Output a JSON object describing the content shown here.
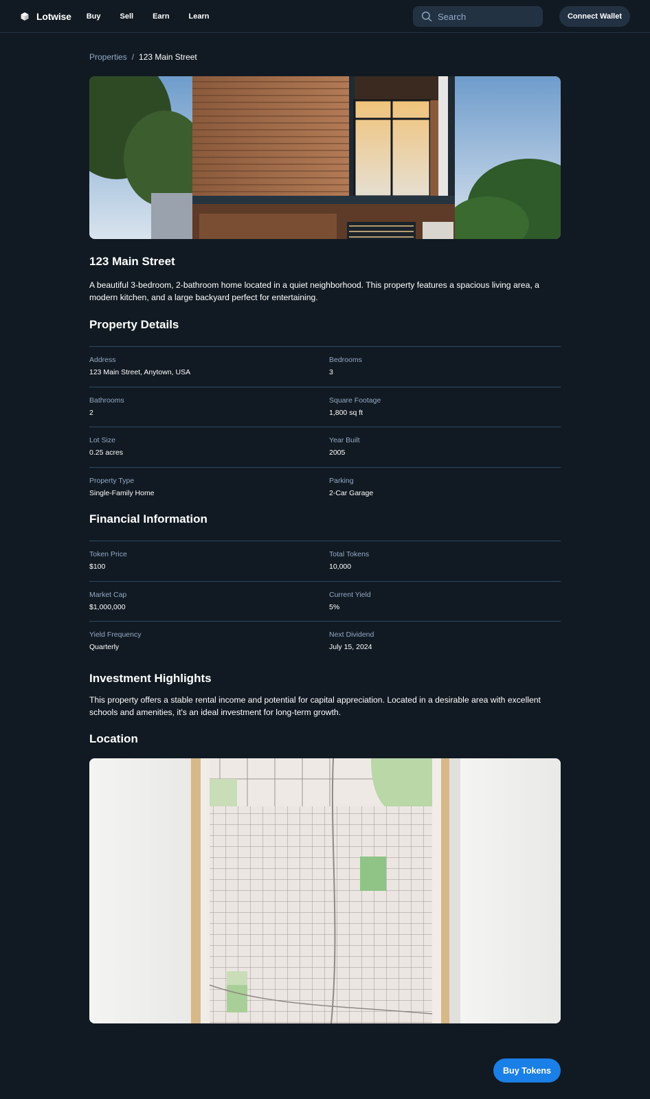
{
  "header": {
    "brand": "Lotwise",
    "nav": [
      "Buy",
      "Sell",
      "Earn",
      "Learn"
    ],
    "search_placeholder": "Search",
    "connect_label": "Connect Wallet"
  },
  "breadcrumb": {
    "parent": "Properties",
    "separator": "/",
    "current": "123 Main Street"
  },
  "property": {
    "title": "123 Main Street",
    "description": "A beautiful 3-bedroom, 2-bathroom home located in a quiet neighborhood. This property features a spacious living area, a modern kitchen, and a large backyard perfect for entertaining."
  },
  "details": {
    "heading": "Property Details",
    "items": [
      {
        "label": "Address",
        "value": "123 Main Street, Anytown, USA"
      },
      {
        "label": "Bedrooms",
        "value": "3"
      },
      {
        "label": "Bathrooms",
        "value": "2"
      },
      {
        "label": "Square Footage",
        "value": "1,800 sq ft"
      },
      {
        "label": "Lot Size",
        "value": "0.25 acres"
      },
      {
        "label": "Year Built",
        "value": "2005"
      },
      {
        "label": "Property Type",
        "value": "Single-Family Home"
      },
      {
        "label": "Parking",
        "value": "2-Car Garage"
      }
    ]
  },
  "financial": {
    "heading": "Financial Information",
    "items": [
      {
        "label": "Token Price",
        "value": "$100"
      },
      {
        "label": "Total Tokens",
        "value": "10,000"
      },
      {
        "label": "Market Cap",
        "value": "$1,000,000"
      },
      {
        "label": "Current Yield",
        "value": "5%"
      },
      {
        "label": "Yield Frequency",
        "value": "Quarterly"
      },
      {
        "label": "Next Dividend",
        "value": "July 15, 2024"
      }
    ]
  },
  "highlights": {
    "heading": "Investment Highlights",
    "text": "This property offers a stable rental income and potential for capital appreciation. Located in a desirable area with excellent schools and amenities, it's an ideal investment for long-term growth."
  },
  "location": {
    "heading": "Location"
  },
  "actions": {
    "buy_label": "Buy Tokens"
  },
  "colors": {
    "background": "#111a22",
    "surface": "#233243",
    "divider": "#324a62",
    "muted_text": "#92a9c9",
    "accent": "#1a7fe6"
  }
}
